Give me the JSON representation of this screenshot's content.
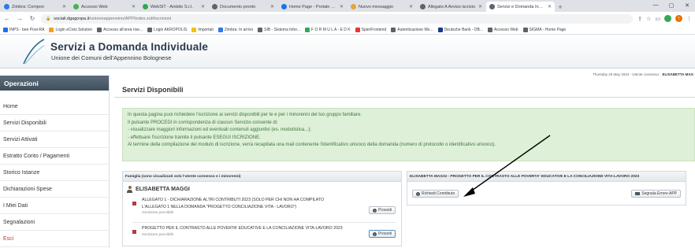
{
  "browser": {
    "tabs": [
      {
        "title": "Zimbra: Compon",
        "color": "#2d7be5"
      },
      {
        "title": "Accesso Web",
        "color": "#4caf50"
      },
      {
        "title": "WebSIT - Ambito S.r.l.",
        "color": "#34a853"
      },
      {
        "title": "Documento pronto",
        "color": "#5f6368"
      },
      {
        "title": "Home Page - Portale ente",
        "color": "#1a73e8"
      },
      {
        "title": "Nuovo messaggio",
        "color": "#e8a33d"
      },
      {
        "title": "Allegato A Avviso iscrizio",
        "color": "#5f6368"
      },
      {
        "title": "Servizi e Domanda Individ",
        "color": "#5f6368"
      }
    ],
    "new_tab": "+",
    "url_host": "sociali.dgagovpa.it",
    "url_path": "/unionea­ppennino/APP/index.zul#iscrizioni"
  },
  "bookmarks": [
    {
      "label": "INPS - bee Post-RA",
      "color": "#1a73e8"
    },
    {
      "label": "Login eCivis Solution",
      "color": "#f4a020"
    },
    {
      "label": "Accesso all'area rise...",
      "color": "#5f6368"
    },
    {
      "label": "Login AKROPOLIS",
      "color": "#5f6368"
    },
    {
      "label": "Importati",
      "color": "#f4c20d"
    },
    {
      "label": "Zimbra: In arrivo",
      "color": "#2d7be5"
    },
    {
      "label": "SIB - Sistema Infor...",
      "color": "#5f6368"
    },
    {
      "label": "F O R M U L A - E D K",
      "color": "#34a853"
    },
    {
      "label": "SpierFrontend",
      "color": "#e53935"
    },
    {
      "label": "Autenticazione Mo...",
      "color": "#5f6368"
    },
    {
      "label": "Deutsche Bank - DB...",
      "color": "#1a3a8a"
    },
    {
      "label": "Accesso Web",
      "color": "#5f6368"
    },
    {
      "label": "SIGMA - Home Page",
      "color": "#5f6368"
    }
  ],
  "app": {
    "title": "Servizi a Domanda Individuale",
    "subtitle": "Unione dei Comuni dell'Appennino Bolognese"
  },
  "sidebar": {
    "heading": "Operazioni",
    "items": [
      {
        "label": "Home"
      },
      {
        "label": "Servizi Disponibili"
      },
      {
        "label": "Servizi Attivati"
      },
      {
        "label": "Estratto Conto / Pagamenti"
      },
      {
        "label": "Storico Istanze"
      },
      {
        "label": "Dichiarazioni Spese"
      },
      {
        "label": "I Miei Dati"
      },
      {
        "label": "Segnalazioni"
      },
      {
        "label": "Esci"
      }
    ]
  },
  "user_bar": {
    "prefix": "Thursday 25 May 2023 - Utente connesso :",
    "user": "ELISABETTA MAG"
  },
  "page": {
    "title": "Servizi Disponibili",
    "info_lines": [
      "In questa pagina puoi richiedere l'iscrizione ai servizi disponibili per te e per i minorenni del tuo gruppo familiare.",
      "Il pulsante PROCEDI in corrispondenza di ciascun Servizio consente di:",
      "- visualizzare maggiori informazioni ed eventuali contenuti aggiuntivi (es. modulistica...);",
      "- effettuare l'iscrizione tramite il pulsante ESEGUI ISCRIZIONE.",
      "Al termine della compilazione del modulo di iscrizione, verrà recapitata una mail contenente l'identificativo univoco della domanda (numero di protocollo o identificativo univoco)."
    ]
  },
  "family_panel": {
    "heading": "Famiglia (sono visualizzati solo l'utente connesso e i minorenni)",
    "person": "ELISABETTA MAGGI",
    "services": [
      {
        "line1": "ALLEGATO 1 - DICHIARAZIONE ALTRI CONTRIBUTI 2023 (SOLO PER CHI NON HA COMPILATO",
        "line2": "L'ALLEGATO 1 NELLA DOMANDA \"PROGETTO CONCILIAZIONE VITA - LAVORO\")",
        "status": "Iscrizione possibile",
        "button": "Procedi"
      },
      {
        "line1": "PROGETTO PER IL CONTRASTO ALLE POVERTA' EDUCATIVE E LA CONCILIAZIONE VITA-LAVORO 2023",
        "line2": "",
        "status": "Iscrizione possibile",
        "button": "Procedi"
      }
    ]
  },
  "detail_panel": {
    "heading": "ELISABETTA MAGGI - PROGETTO PER IL CONTRASTO ALLE POVERTA' EDUCATIVE E LA CONCILIAZIONE VITA-LAVORO 2023",
    "request_button": "Richiedi Contributo",
    "report_button": "Segnala Errore APP"
  }
}
